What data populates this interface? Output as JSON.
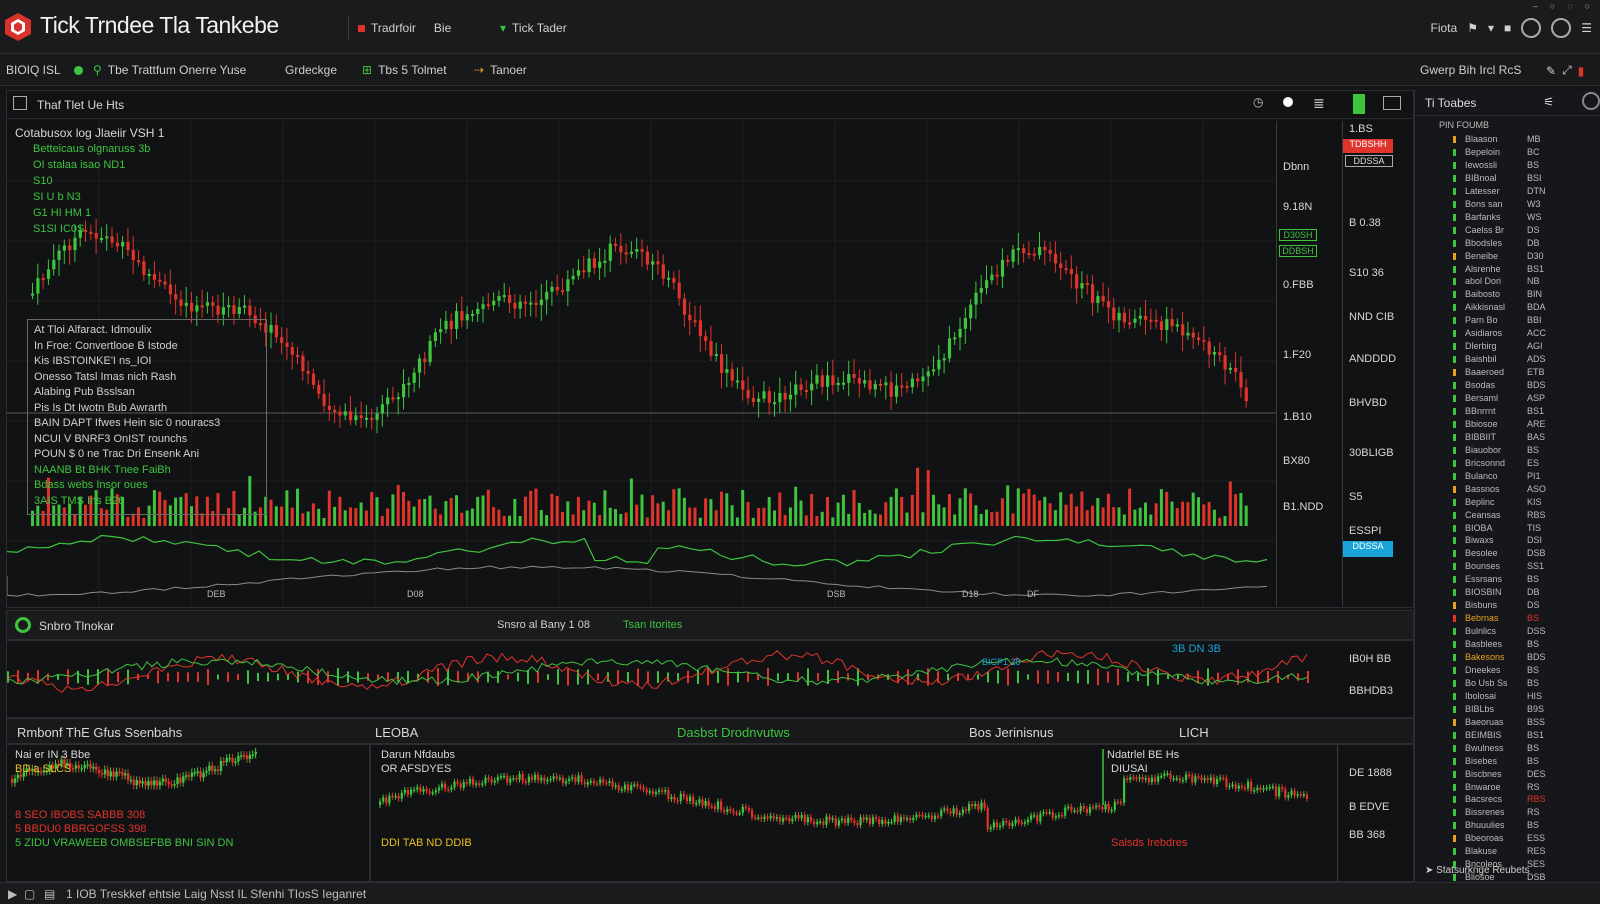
{
  "app": {
    "title": "Tick Trndee Tla Tankebe",
    "tab1_label": "Tradrfoir",
    "tab1_suffix": "Bie",
    "tab2_label": "Tick Tader",
    "right_label": "Fiota"
  },
  "toolbar": {
    "symbol": "BIOIQ ISL",
    "feed_label": "Tbe Trattfum Onerre Yuse",
    "mode_label": "Grdeckge",
    "tool_label": "Tbs 5 Tolmet",
    "tool2_label": "Tanoer",
    "right_label": "Gwerp Bih Ircl RcS"
  },
  "chart": {
    "header_label": "Thaf Tlet Ue Hts",
    "info_lines": [
      "Cotabusox log Jlaeiir VSH 1",
      "Betteicaus olgnaruss 3b",
      "OI stalaa isao ND1",
      "S10",
      "SI U b N3",
      "G1 HI HM 1",
      "S1SI IC0S"
    ],
    "overlay_lines": [
      "At Tloi Alfaract. Idmoulix",
      "In Froe: Convertlooe B Istode",
      "Kis IBSTOINKE'I ns_IOI",
      "Onesso Tatsl Imas nich Rash",
      "Alabing Pub Bsslsan",
      "Pis Is Dt Iwotn Bub Awrarth",
      "BAIN DAPT Ifwes Hein sic 0 nouracs3",
      "NCUI V BNRF3 OnIST rounchs",
      "POUN $ 0 ne Trac Dri Ensenk Ani",
      "NAANB Bt BHK Tnee FaiBh",
      "Bdass webs Insor oues",
      "3AIS TMS Ins B26"
    ],
    "price_ticks": [
      "Dbnn",
      "9.18N",
      "0.FBB",
      "1.F20",
      "1.B10",
      "BX80",
      "B1.NDD"
    ],
    "price_ticks_2": [
      "1.BS",
      "B 0.38",
      "S10 36",
      "NND CIB",
      "ANDDDD",
      "BHVBD",
      "30BLIGB",
      "S5",
      "ESSPI"
    ],
    "tags": {
      "sell": "TDBSHH",
      "sell2": "DDSSA",
      "green1": "D30SH",
      "green2": "DDBSH",
      "blue": "DDSSA"
    },
    "bottom_labels": [
      "DEB",
      "D08",
      "DSB",
      "D18",
      "DF"
    ]
  },
  "indicator_bar": {
    "label": "Snbro Tlnokar",
    "center_label": "Snsro al Bany 1 08",
    "center_green": "Tsan Itorites"
  },
  "oscillator": {
    "value_blue": "3B DN 3B",
    "value_small": "BICP1 28",
    "right_top": "IB0H BB",
    "right_bottom": "BBHDB3"
  },
  "summary": {
    "left": "Rmbonf ThE Gfus Ssenbahs",
    "mid": "LEOBA",
    "green": "Dasbst Drodnvutws",
    "right": "Bos Jerinisnus",
    "far": "LICH"
  },
  "mini1": {
    "title": "Nai er IN 3 Bbe",
    "sub": "BD a SLCS",
    "line1": "8 SEO IBOBS SABBB 308",
    "line2": "5 BBDU0 BBRGOFSS 398",
    "line3": "5 ZIDU VRAWEEB OMBSEFBB BNI SIN DN"
  },
  "mini2": {
    "title": "Darun Nfdaubs",
    "sub": "OR AFSDYES",
    "footer": "DDI TAB ND DDIB",
    "right_title": "Ndatrlel BE Hs",
    "right_sub": "DIUSAI",
    "right_footer": "Salsds Irebdres",
    "ticks": [
      "DE 1888",
      "B EDVE",
      "BB 368"
    ]
  },
  "watchlist": {
    "title": "Ti Toabes",
    "header_row": "PIN FOUMB",
    "rows": [
      [
        "Blaason",
        "MB"
      ],
      [
        "Bepeloin",
        "BC"
      ],
      [
        "Iewossli",
        "BS"
      ],
      [
        "BIBnoal",
        "BSI"
      ],
      [
        "Latesser",
        "DTN"
      ],
      [
        "Bons san",
        "W3"
      ],
      [
        "Barfanks",
        "WS"
      ],
      [
        "Caelss Br",
        "DS"
      ],
      [
        "Bbodsles",
        "DB"
      ],
      [
        "Beneibe",
        "D30"
      ],
      [
        "Alsrenhe",
        "BS1"
      ],
      [
        "abol Dori",
        "NB"
      ],
      [
        "Baibosto",
        "BIN"
      ],
      [
        "Aikkisnasl",
        "BDA"
      ],
      [
        "Parn Bo",
        "BBI"
      ],
      [
        "Asidiaros",
        "ACC"
      ],
      [
        "Dlerbirg",
        "AGI"
      ],
      [
        "Baishbil",
        "ADS"
      ],
      [
        "Baaeroed",
        "ETB"
      ],
      [
        "Bsodas",
        "BDS"
      ],
      [
        "Bersaml",
        "ASP"
      ],
      [
        "BBnrrnt",
        "BS1"
      ],
      [
        "Bbiosoe",
        "ARE"
      ],
      [
        "BIBBIIT",
        "BAS"
      ],
      [
        "Biauobor",
        "BS"
      ],
      [
        "Bricsonnd",
        "ES"
      ],
      [
        "Bulanco",
        "PI1"
      ],
      [
        "Bassnos",
        "ASO"
      ],
      [
        "Beplinc",
        "KIS"
      ],
      [
        "Ceansas",
        "RBS"
      ],
      [
        "BIOBA",
        "TIS"
      ],
      [
        "Biwaxs",
        "DSI"
      ],
      [
        "Besolee",
        "DSB"
      ],
      [
        "Bounses",
        "SS1"
      ],
      [
        "Essrsans",
        "BS"
      ],
      [
        "BIOSBIN",
        "DB"
      ],
      [
        "Bisbuns",
        "DS"
      ],
      [
        "Bebrnas",
        "BS"
      ],
      [
        "Bulnlics",
        "DSS"
      ],
      [
        "Basblees",
        "BS"
      ],
      [
        "Bakesons",
        "BDS"
      ],
      [
        "Dneekes",
        "BS"
      ],
      [
        "Bo Usb Ss",
        "BS"
      ],
      [
        "Ibolosai",
        "HIS"
      ],
      [
        "BIBLbs",
        "B9S"
      ],
      [
        "Baeoruas",
        "BSS"
      ],
      [
        "BEIMBIS",
        "BS1"
      ],
      [
        "Bwulness",
        "BS"
      ],
      [
        "Bisebes",
        "BS"
      ],
      [
        "Biscbnes",
        "DES"
      ],
      [
        "Bnwaroe",
        "RS"
      ],
      [
        "Bacsrecs",
        "RBS"
      ],
      [
        "Bissrenes",
        "RS"
      ],
      [
        "Bhuuulies",
        "BS"
      ],
      [
        "Bbeoroas",
        "ESS"
      ],
      [
        "Blakuse",
        "RES"
      ],
      [
        "Bncoleos",
        "SES"
      ],
      [
        "Bliosoe",
        "DSB"
      ]
    ],
    "footer": "Statsurknge Reubets"
  },
  "statusbar": {
    "text": "1 IOB Treskkef ehtsie  Laig  Nsst IL  Sfenhi TIosS  Ieganret"
  },
  "colors": {
    "up": "#3ec43e",
    "down": "#e0342a",
    "accent_blue": "#1aa3d6",
    "logo": "#d8322a"
  }
}
